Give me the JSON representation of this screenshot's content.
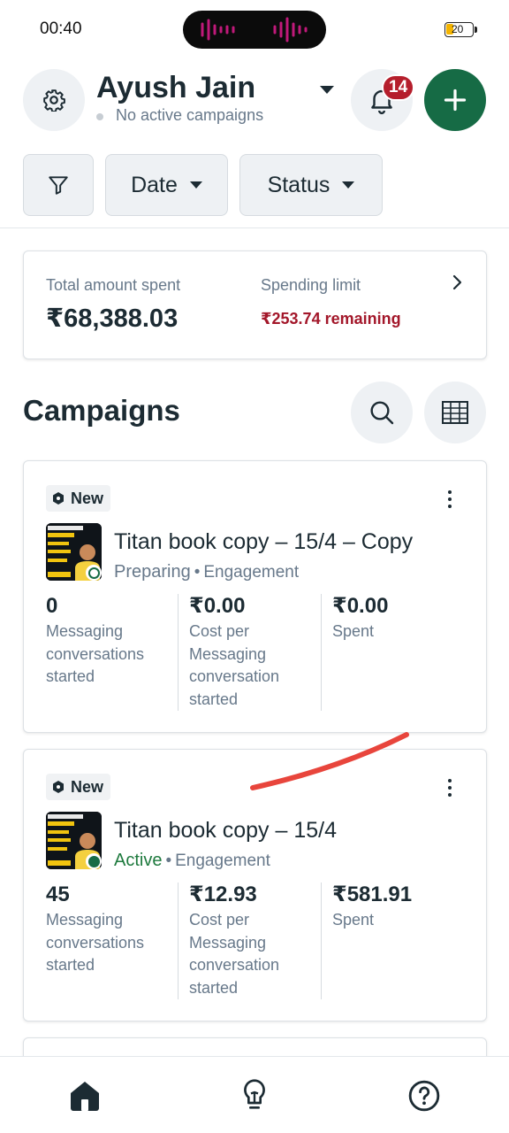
{
  "status_bar": {
    "time": "00:40",
    "battery": "20"
  },
  "header": {
    "account_name": "Ayush Jain",
    "account_status": "No active campaigns",
    "notification_count": "14"
  },
  "filters": {
    "date_label": "Date",
    "status_label": "Status"
  },
  "spend": {
    "total_label": "Total amount spent",
    "total_value": "₹68,388.03",
    "limit_label": "Spending limit",
    "limit_remaining": "₹253.74 remaining"
  },
  "campaigns": {
    "title": "Campaigns",
    "items": [
      {
        "tag": "New",
        "name": "Titan book copy – 15/4 – Copy",
        "status": "Preparing",
        "objective": "Engagement",
        "metrics": [
          {
            "value": "0",
            "label": "Messaging\nconversations\nstarted"
          },
          {
            "value": "₹0.00",
            "label": "Cost per\nMessaging\nconversation\nstarted"
          },
          {
            "value": "₹0.00",
            "label": "Spent"
          }
        ]
      },
      {
        "tag": "New",
        "name": "Titan book copy – 15/4",
        "status": "Active",
        "objective": "Engagement",
        "metrics": [
          {
            "value": "45",
            "label": "Messaging\nconversations\nstarted"
          },
          {
            "value": "₹12.93",
            "label": "Cost per\nMessaging\nconversation\nstarted"
          },
          {
            "value": "₹581.91",
            "label": "Spent"
          }
        ]
      }
    ]
  },
  "icons": {
    "settings": "gear-icon",
    "notifications": "bell-icon",
    "create": "plus-icon",
    "filter": "funnel-icon",
    "search": "search-icon",
    "table": "table-icon",
    "home": "home-icon",
    "ideas": "lightbulb-icon",
    "help": "help-icon"
  },
  "colors": {
    "primary_green": "#166b45",
    "badge_red": "#b51e2c",
    "remaining_red": "#a3172a",
    "active_green": "#1e7a3e",
    "annotation_red": "#e8453c"
  }
}
